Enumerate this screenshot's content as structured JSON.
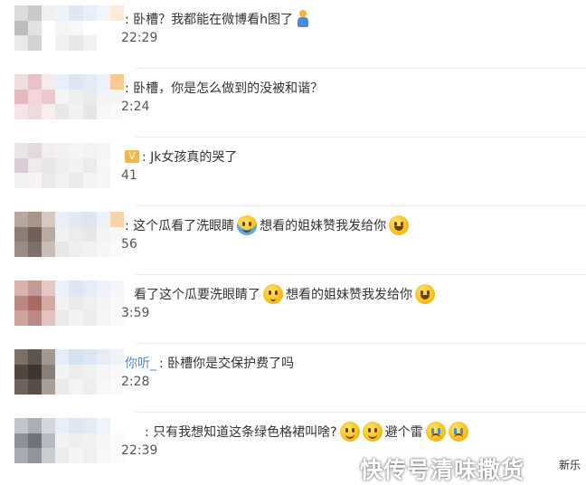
{
  "comments": [
    {
      "text_parts": [
        ": 卧槽？我都能在微博看h图了"
      ],
      "emoji_after": "figure-icon",
      "time": "22:29"
    },
    {
      "text_parts": [
        ": 卧槽，你是怎么做到的没被和谐？"
      ],
      "time": "2:24"
    },
    {
      "prefix_badge": "V",
      "text_parts": [
        ": Jk女孩真的哭了"
      ],
      "time": "41"
    },
    {
      "text_parts": [
        ": 这个瓜看了洗眼睛",
        "想看的姐妹赞我发给你"
      ],
      "emojis": [
        "wash-eyes-emoji",
        "laugh-cry-emoji"
      ],
      "time": "56"
    },
    {
      "text_parts": [
        "看了这个瓜要洗眼睛了",
        "想看的姐妹赞我发给你"
      ],
      "emojis": [
        "thinking-emoji",
        "laugh-cry-emoji"
      ],
      "time": "3:59"
    },
    {
      "name_fragment": "你听_",
      "text_parts": [
        ": 卧槽你是交保护费了吗"
      ],
      "time": "2:28"
    },
    {
      "text_parts": [
        ": 只有我想知道这条绿色格裙叫啥?",
        "避个雷"
      ],
      "emojis": [
        "smile-emoji",
        "smile-emoji",
        "crying-emoji",
        "crying-emoji"
      ],
      "time": "22:39"
    }
  ],
  "watermark": "快传号清味撒货",
  "edge_text": "新乐",
  "colors": {
    "link_blue": "#5a86c8",
    "badge_orange": "#f3b64a",
    "divider": "#ececec"
  }
}
